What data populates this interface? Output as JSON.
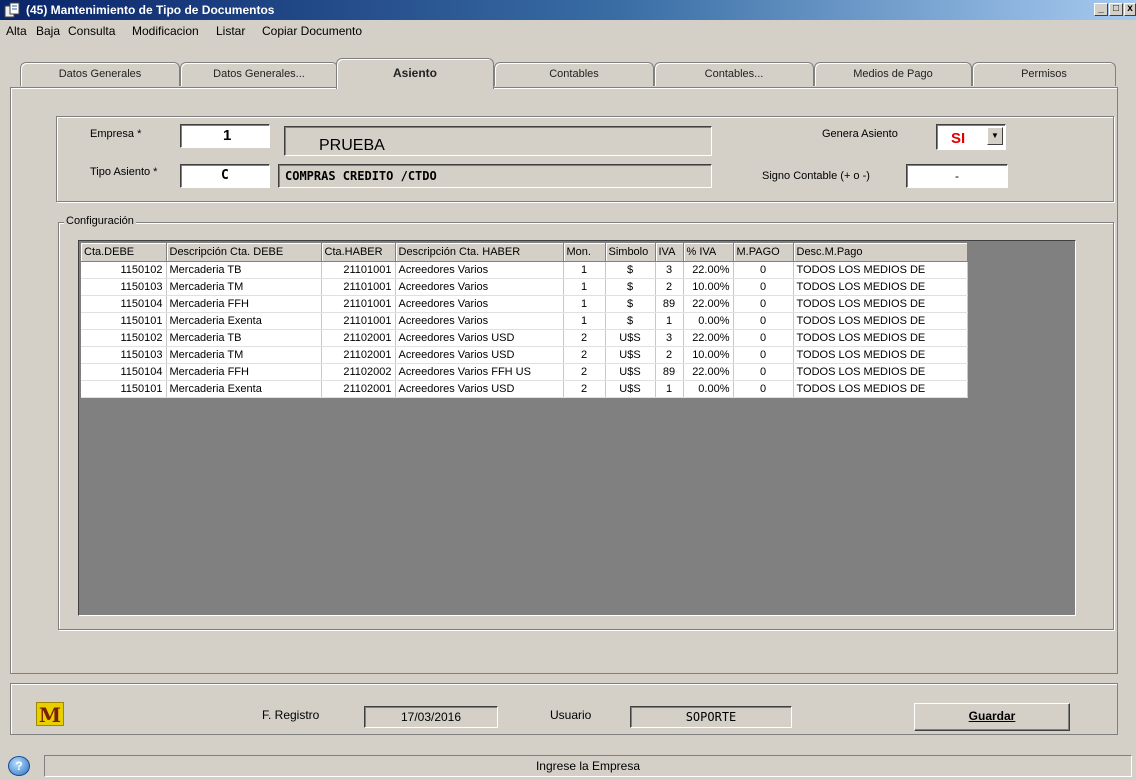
{
  "window": {
    "title": "(45) Mantenimiento de Tipo de Documentos"
  },
  "menu": [
    {
      "label": "Alta"
    },
    {
      "label": "Baja"
    },
    {
      "label": "Consulta"
    },
    {
      "label": "Modificacion"
    },
    {
      "label": "Listar"
    },
    {
      "label": "Copiar Documento"
    }
  ],
  "tabs": [
    {
      "label": "Datos Generales"
    },
    {
      "label": "Datos Generales..."
    },
    {
      "label": "Asiento"
    },
    {
      "label": "Contables"
    },
    {
      "label": "Contables..."
    },
    {
      "label": "Medios de Pago"
    },
    {
      "label": "Permisos"
    }
  ],
  "active_tab": "Asiento",
  "form": {
    "empresa_label": "Empresa *",
    "empresa_code": "1",
    "empresa_name": "PRUEBA",
    "tipo_asiento_label": "Tipo Asiento *",
    "tipo_asiento_code": "C",
    "tipo_asiento_name": "COMPRAS CREDITO /CTDO",
    "genera_asiento_label": "Genera Asiento",
    "genera_asiento_value": "SI",
    "signo_label": "Signo Contable  (+ o -)",
    "signo_value": "-"
  },
  "config": {
    "title": "Configuración",
    "columns": [
      "Cta.DEBE",
      "Descripción Cta. DEBE",
      "Cta.HABER",
      "Descripción Cta. HABER",
      "Mon.",
      "Simbolo",
      "IVA",
      "% IVA",
      "M.PAGO",
      "Desc.M.Pago"
    ],
    "rows": [
      [
        "1150102",
        "Mercaderia TB",
        "21101001",
        "Acreedores Varios",
        "1",
        "$",
        "3",
        "22.00%",
        "0",
        "TODOS LOS MEDIOS DE"
      ],
      [
        "1150103",
        "Mercaderia TM",
        "21101001",
        "Acreedores Varios",
        "1",
        "$",
        "2",
        "10.00%",
        "0",
        "TODOS LOS MEDIOS DE"
      ],
      [
        "1150104",
        "Mercaderia FFH",
        "21101001",
        "Acreedores Varios",
        "1",
        "$",
        "89",
        "22.00%",
        "0",
        "TODOS LOS MEDIOS DE"
      ],
      [
        "1150101",
        "Mercaderia Exenta",
        "21101001",
        "Acreedores Varios",
        "1",
        "$",
        "1",
        "0.00%",
        "0",
        "TODOS LOS MEDIOS DE"
      ],
      [
        "1150102",
        "Mercaderia TB",
        "21102001",
        "Acreedores Varios USD",
        "2",
        "U$S",
        "3",
        "22.00%",
        "0",
        "TODOS LOS MEDIOS DE"
      ],
      [
        "1150103",
        "Mercaderia TM",
        "21102001",
        "Acreedores Varios USD",
        "2",
        "U$S",
        "2",
        "10.00%",
        "0",
        "TODOS LOS MEDIOS DE"
      ],
      [
        "1150104",
        "Mercaderia FFH",
        "21102002",
        "Acreedores Varios FFH US",
        "2",
        "U$S",
        "89",
        "22.00%",
        "0",
        "TODOS LOS MEDIOS DE"
      ],
      [
        "1150101",
        "Mercaderia Exenta",
        "21102001",
        "Acreedores Varios USD",
        "2",
        "U$S",
        "1",
        "0.00%",
        "0",
        "TODOS LOS MEDIOS DE"
      ]
    ]
  },
  "footer": {
    "logo_letter": "M",
    "f_registro_label": "F. Registro",
    "f_registro_value": "17/03/2016",
    "usuario_label": "Usuario",
    "usuario_value": "SOPORTE",
    "guardar_label": "Guardar"
  },
  "status": {
    "message": "Ingrese la Empresa",
    "help_glyph": "?"
  }
}
